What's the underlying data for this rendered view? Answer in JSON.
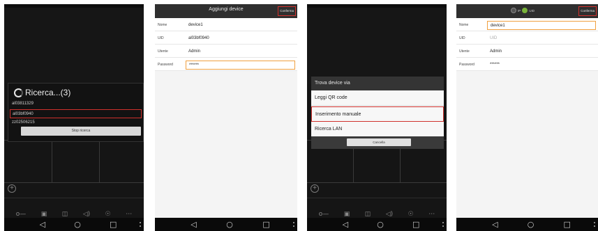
{
  "screen1": {
    "search": {
      "title": "Ricerca...(3)",
      "results": [
        "al03811329",
        "al03bf0940",
        "zz02506215"
      ],
      "selected_index": 1,
      "stop_label": "Stop ricerca"
    },
    "toolbar_icons": [
      "key-icon",
      "camera-icon",
      "video-icon",
      "speaker-icon",
      "mic-icon",
      "more-icon"
    ]
  },
  "screen2": {
    "title": "Aggiungi device",
    "confirm_label": "Conferma",
    "fields": [
      {
        "label": "Nome",
        "value": "device1"
      },
      {
        "label": "UID",
        "value": "al03bf0940"
      },
      {
        "label": "Utente",
        "value": "Admin"
      },
      {
        "label": "Password",
        "value": "******",
        "focused": true
      }
    ]
  },
  "screen3": {
    "dialog": {
      "title": "Trova device via",
      "options": [
        "Leggi QR code",
        "Inserimento manuale",
        "Ricerca LAN"
      ],
      "selected_index": 1,
      "cancel_label": "Cancella"
    }
  },
  "screen4": {
    "toggle": {
      "ip_label": "IP",
      "uid_label": "UID",
      "selected": "UID"
    },
    "confirm_label": "Conferma",
    "fields": [
      {
        "label": "Nome",
        "value": "device1",
        "focused": true
      },
      {
        "label": "UID",
        "value": "UID",
        "placeholder": true
      },
      {
        "label": "Utente",
        "value": "Admin"
      },
      {
        "label": "Password",
        "value": "******"
      }
    ]
  },
  "colors": {
    "highlight": "#d0312d",
    "focus": "#f0a040",
    "accent_green": "#79b33a"
  }
}
